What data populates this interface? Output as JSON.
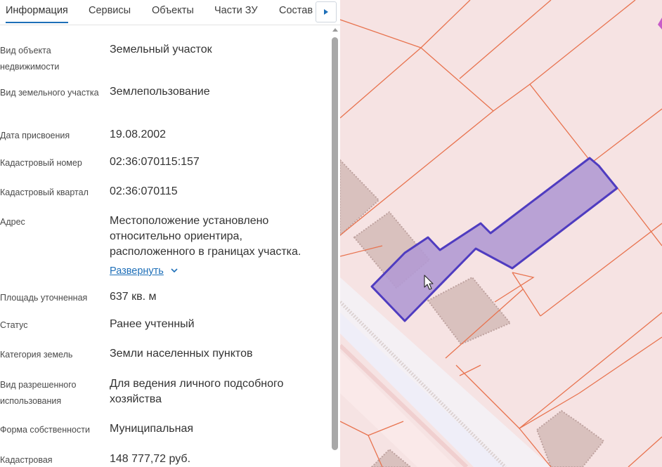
{
  "tabs": [
    {
      "label": "Информация",
      "active": true
    },
    {
      "label": "Сервисы",
      "active": false
    },
    {
      "label": "Объекты",
      "active": false
    },
    {
      "label": "Части ЗУ",
      "active": false
    },
    {
      "label": "Состав",
      "active": false
    }
  ],
  "fields": [
    {
      "label": "Вид объекта недвижимости",
      "value": "Земельный участок"
    },
    {
      "label": "Вид земельного участка",
      "value": "Землепользование"
    },
    {
      "label": "Дата присвоения",
      "value": "19.08.2002"
    },
    {
      "label": "Кадастровый номер",
      "value": "02:36:070115:157"
    },
    {
      "label": "Кадастровый квартал",
      "value": "02:36:070115"
    },
    {
      "label": "Адрес",
      "value": "Местоположение установлено относительно ориентира, расположенного в границах участка."
    },
    {
      "label": "Площадь уточненная",
      "value": "637 кв. м"
    },
    {
      "label": "Статус",
      "value": "Ранее учтенный"
    },
    {
      "label": "Категория земель",
      "value": "Земли населенных пунктов"
    },
    {
      "label": "Вид разрешенного использования",
      "value": "Для ведения личного подсобного хозяйства"
    },
    {
      "label": "Форма собственности",
      "value": "Муниципальная"
    },
    {
      "label": "Кадастровая",
      "value": "148 777,72 руб."
    }
  ],
  "address_expand_label": "Развернуть",
  "icons": {
    "tabs_scroll": "caret-right-icon",
    "expand": "chevron-down-icon",
    "cursor": "mouse-pointer-icon"
  },
  "colors": {
    "accent": "#1e6fb8",
    "parcel_fill": "#b39ad3",
    "parcel_stroke": "#4f3cc0",
    "parcel_boundary": "#e8734f",
    "map_background": "#f6e3e3"
  }
}
